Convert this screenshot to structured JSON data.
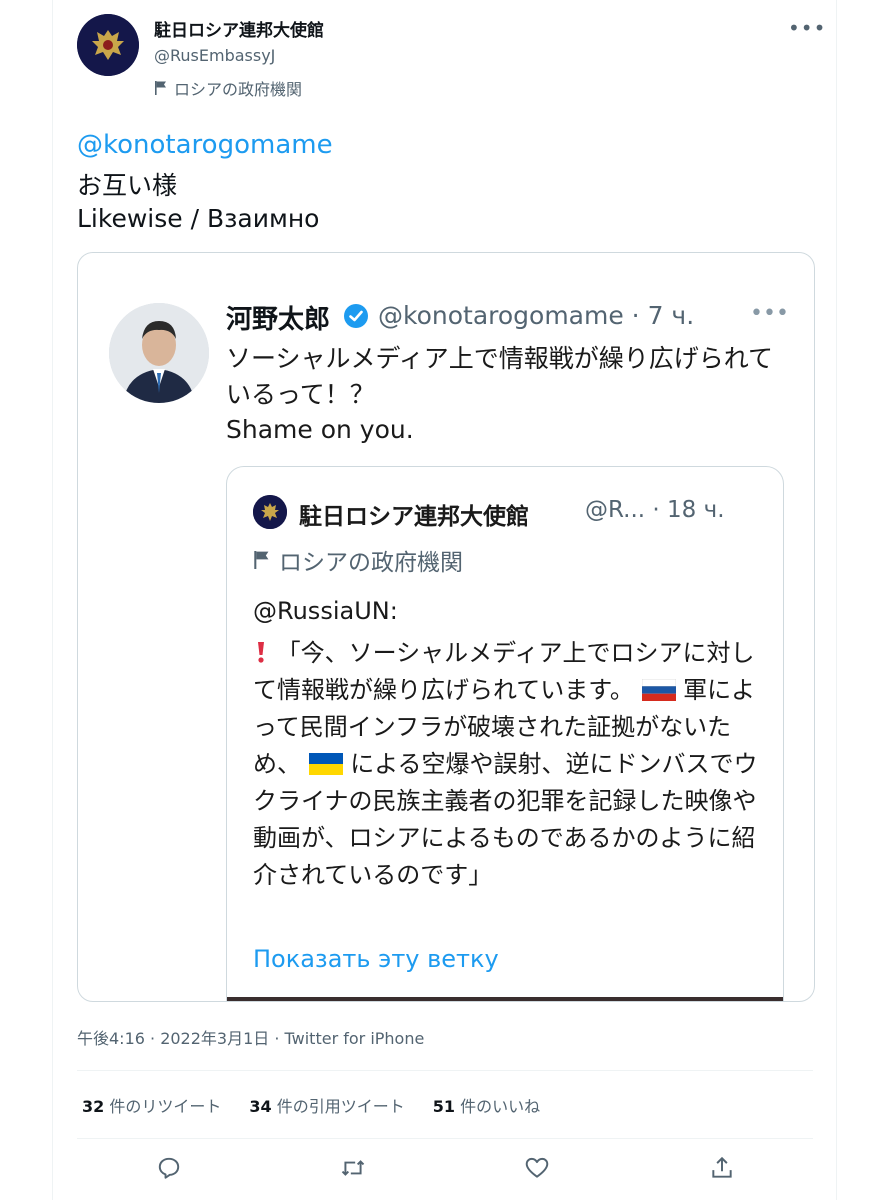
{
  "header": {
    "name": "駐日ロシア連邦大使館",
    "handle": "@RusEmbassyJ",
    "label": "ロシアの政府機関",
    "more": "•••"
  },
  "tweet": {
    "mention": "@konotarogomame",
    "line1": "お互い様",
    "line2": "Likewise / Взаимно"
  },
  "embedded": {
    "kono_name": "河野太郎",
    "kono_handle": "@konotarogomame · 7 ч.",
    "kono_more": "•••",
    "kono_text": "ソーシャルメディア上で情報戦が繰り広げられているって！？",
    "kono_en": "Shame on you.",
    "quote": {
      "name": "駐日ロシア連邦大使館",
      "handle": "@R... · 18 ч.",
      "label": "ロシアの政府機関",
      "mention": "@RussiaUN:",
      "body_1": "「今、ソーシャルメディア上でロシアに対して情報戦が繰り広げられています。",
      "body_2": "軍によって民間インフラが破壊された証拠がないため、",
      "body_3": "による空爆や誤射、逆にドンバスでウクライナの民族主義者の犯罪を記録した映像や動画が、ロシアによるものであるかのように紹介されているのです」",
      "show_thread": "Показать эту ветку"
    }
  },
  "meta": "午後4:16 · 2022年3月1日 · Twitter for iPhone",
  "stats": {
    "retweets_count": "32",
    "retweets_label": "件のリツイート",
    "quotes_count": "34",
    "quotes_label": "件の引用ツイート",
    "likes_count": "51",
    "likes_label": "件のいいね"
  },
  "colors": {
    "accent": "#1d9bf0",
    "secondary_text": "#536471",
    "border": "#cfd9de"
  }
}
